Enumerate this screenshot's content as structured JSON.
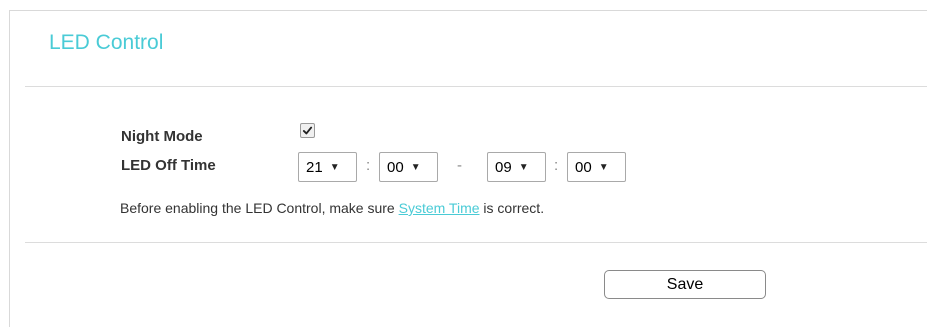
{
  "panel": {
    "title": "LED Control"
  },
  "night_mode": {
    "label": "Night Mode",
    "checked": true
  },
  "led_off_time": {
    "label": "LED Off Time",
    "start_hour": "21",
    "start_minute": "00",
    "end_hour": "09",
    "end_minute": "00",
    "colon": ":",
    "range_separator": "-"
  },
  "note": {
    "prefix": "Before enabling the LED Control, make sure ",
    "link_text": "System Time",
    "suffix": " is correct."
  },
  "actions": {
    "save_label": "Save"
  },
  "icons": {
    "dropdown": "caret-down-icon",
    "checkbox": "checkmark-icon"
  },
  "colors": {
    "accent": "#4acbd6",
    "text": "#333333",
    "divider": "#dcdcdc"
  }
}
